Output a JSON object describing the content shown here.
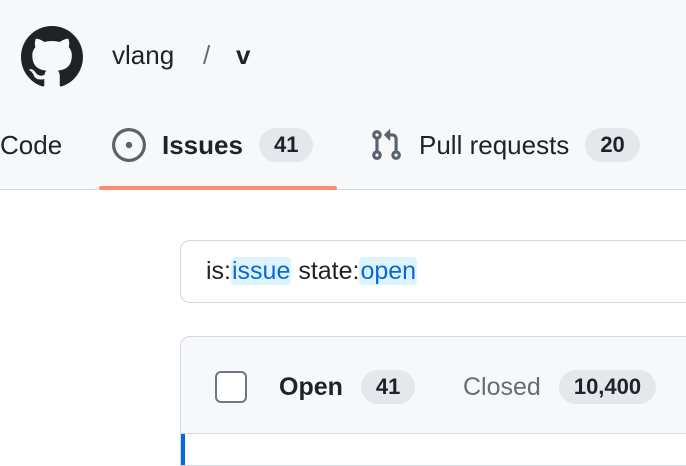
{
  "repo": {
    "owner": "vlang",
    "separator": "/",
    "name": "v"
  },
  "tabs": [
    {
      "label": "Code",
      "icon": "code-icon"
    },
    {
      "label": "Issues",
      "icon": "issue-opened-icon",
      "count": "41",
      "selected": true
    },
    {
      "label": "Pull requests",
      "icon": "git-pull-request-icon",
      "count": "20"
    }
  ],
  "search": {
    "parts": [
      {
        "text": "is:"
      },
      {
        "text": "issue",
        "highlight": true
      },
      {
        "text": " state:"
      },
      {
        "text": "open",
        "highlight": true
      }
    ]
  },
  "list": {
    "open_label": "Open",
    "open_count": "41",
    "closed_label": "Closed",
    "closed_count": "10,400"
  },
  "colors": {
    "accent": "#0969da",
    "tab_underline": "#fd8c73",
    "header_bg": "#f6f8fa"
  }
}
